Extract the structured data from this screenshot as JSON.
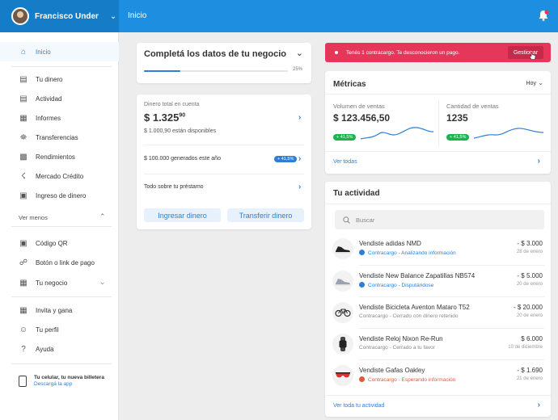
{
  "header": {
    "user_name": "Francisco Under",
    "page_title": "Inicio",
    "accent": "#1e8fe0"
  },
  "sidebar": {
    "items": [
      {
        "label": "Inicio",
        "icon": "home-icon"
      },
      {
        "label": "Tu dinero",
        "icon": "money-icon"
      },
      {
        "label": "Actividad",
        "icon": "activity-icon"
      },
      {
        "label": "Informes",
        "icon": "reports-icon"
      },
      {
        "label": "Transferencias",
        "icon": "bank-icon"
      },
      {
        "label": "Rendimientos",
        "icon": "chart-icon"
      },
      {
        "label": "Mercado Crédito",
        "icon": "credit-icon"
      },
      {
        "label": "Ingreso de dinero",
        "icon": "deposit-icon"
      },
      {
        "label": "Código QR",
        "icon": "qr-icon"
      },
      {
        "label": "Botón o link de pago",
        "icon": "link-icon"
      },
      {
        "label": "Tu negocio",
        "icon": "store-icon"
      },
      {
        "label": "Invita y gana",
        "icon": "gift-icon"
      },
      {
        "label": "Tu perfil",
        "icon": "profile-icon"
      },
      {
        "label": "Ayuda",
        "icon": "help-icon"
      }
    ],
    "ver_menos": "Ver menos",
    "wallet_title": "Tu celular, tu nueva billetera",
    "wallet_link": "Descargá la app"
  },
  "setup_card": {
    "title": "Completá los datos de tu negocio",
    "progress_label": "25%",
    "progress": 0.25
  },
  "money_card": {
    "label": "Dinero total en cuenta",
    "amount": "$ 1.325",
    "cents": "90",
    "available": "$ 1.000,90 están disponibles",
    "generated": "$ 100.000 generados este año",
    "generated_badge": "+ 41,5%",
    "loan": "Todo sobre tu préstamo",
    "btn_deposit": "Ingresar dinero",
    "btn_transfer": "Transferir dinero"
  },
  "alert": {
    "text": "Tenés 1 contracargo. Te desconocieron un pago.",
    "button": "Gestionar",
    "color": "#e6375a"
  },
  "metrics": {
    "title": "Métricas",
    "period": "Hoy",
    "sales_label": "Volumen de ventas",
    "sales_value": "$ 123.456,50",
    "sales_badge": "+ 41,5%",
    "count_label": "Cantidad de ventas",
    "count_value": "1235",
    "count_badge": "+ 41,5%",
    "see_all": "Ver todas"
  },
  "activity": {
    "title": "Tu actividad",
    "search_placeholder": "Buscar",
    "rows": [
      {
        "title": "Vendiste adidas NMD",
        "status": "Contracargo - Analizando información",
        "status_type": "blue",
        "amount": "- $ 3.000",
        "date": "28 de enero",
        "icon": "sneaker-icon"
      },
      {
        "title": "Vendiste New Balance Zapatillas NB574",
        "status": "Contracargo - Disputándose",
        "status_type": "blue",
        "amount": "- $ 5.000",
        "date": "20 de enero",
        "icon": "sneaker-icon"
      },
      {
        "title": "Vendiste Bicicleta Aventon Mataro T52",
        "status": "Contracargo - Cerrado con dinero retenido",
        "status_type": "gray",
        "amount": "- $ 20.000",
        "date": "20 de enero",
        "icon": "bicycle-icon"
      },
      {
        "title": "Vendiste Reloj Nixon Re-Run",
        "status": "Contracargo - Cerrado a tu favor",
        "status_type": "gray",
        "amount": "$ 6.000",
        "date": "10 de diciembre",
        "icon": "watch-icon"
      },
      {
        "title": "Vendiste Gafas Oakley",
        "status": "Contracargo - Esperando información",
        "status_type": "red",
        "amount": "- $ 1.690",
        "date": "21 de enero",
        "icon": "sunglasses-icon"
      }
    ],
    "see_all": "Ver toda tu actividad"
  }
}
